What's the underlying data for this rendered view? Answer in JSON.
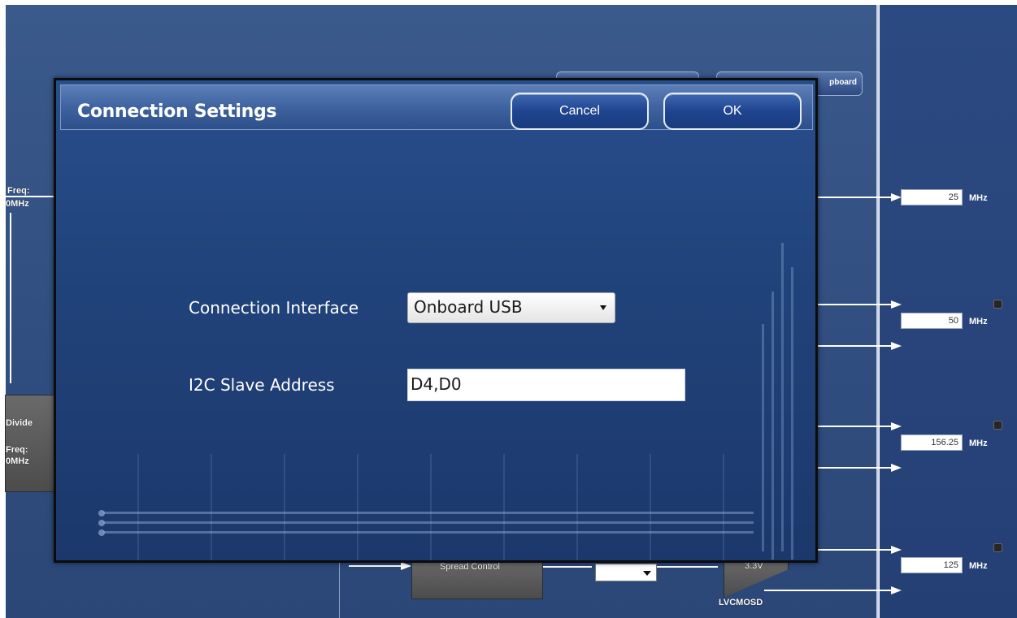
{
  "dialog": {
    "title": "Connection Settings",
    "cancel_label": "Cancel",
    "ok_label": "OK",
    "connection_interface": {
      "label": "Connection Interface",
      "selected": "Onboard USB"
    },
    "i2c_slave_address": {
      "label": "I2C Slave Address",
      "value": "D4,D0"
    }
  },
  "background": {
    "top_button_right_label": "pboard",
    "left_panel": {
      "freq_label_1": "Freq:",
      "freq_value_1": "0MHz",
      "divide_label": "Divide",
      "freq_label_2": "Freq:",
      "freq_value_2": "0MHz"
    },
    "outputs": [
      {
        "value": "25",
        "unit": "MHz"
      },
      {
        "value": "50",
        "unit": "MHz"
      },
      {
        "value": "156.25",
        "unit": "MHz"
      },
      {
        "value": "125",
        "unit": "MHz"
      }
    ],
    "spread_control_label": "Spread Control",
    "voltage_label": "3.3V",
    "lvcmos_label": "LVCMOSD"
  },
  "colors": {
    "dialog_background": "#20427a",
    "header_gradient": "#4a6dab",
    "button_background": "#1f4590",
    "app_background": "#35558a"
  }
}
